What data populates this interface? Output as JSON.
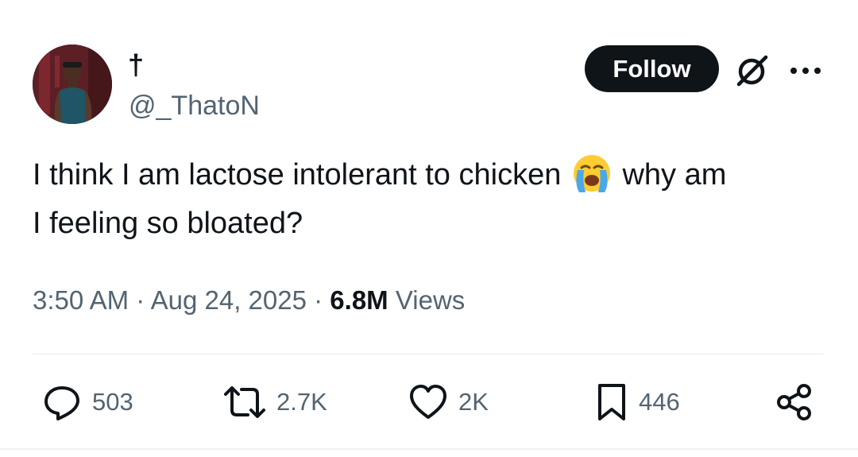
{
  "author": {
    "display_name": "†",
    "handle": "@_ThatoN"
  },
  "header": {
    "follow_label": "Follow",
    "grok_icon": "grok-icon",
    "more_icon": "more-icon"
  },
  "tweet": {
    "text_line1_before": "I think I am lactose intolerant to chicken",
    "emoji": "loudly-crying-face",
    "text_line1_after": "why am",
    "text_line2": "I feeling so bloated?"
  },
  "meta": {
    "time": "3:50 AM",
    "separator1": "·",
    "date": "Aug 24, 2025",
    "separator2": "·",
    "views_count": "6.8M",
    "views_label": "Views"
  },
  "actions": {
    "replies": "503",
    "reposts": "2.7K",
    "likes": "2K",
    "bookmarks": "446"
  },
  "colors": {
    "text_primary": "#0f1419",
    "text_secondary": "#536471",
    "follow_bg": "#0f1419",
    "divider": "#e7eaed"
  }
}
